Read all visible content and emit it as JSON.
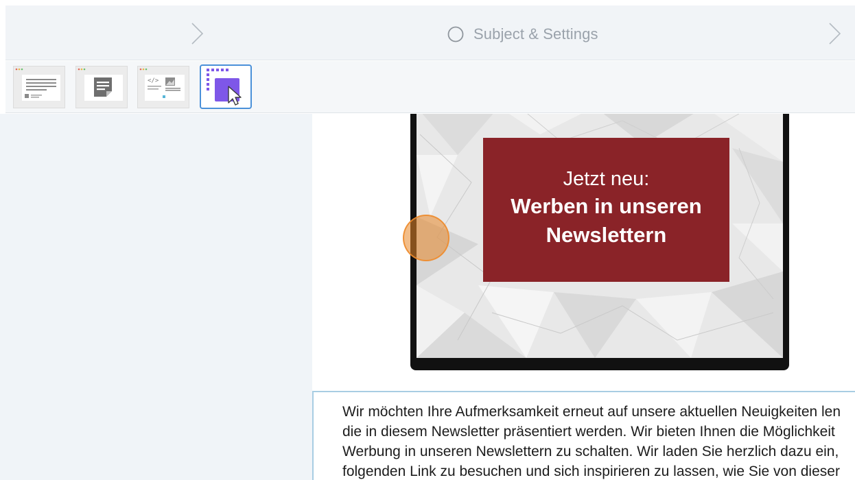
{
  "stepbar": {
    "current_step_label": "Subject & Settings"
  },
  "toolbar": {
    "thumbnails": [
      {
        "name": "text-layout-template",
        "selected": false
      },
      {
        "name": "note-template",
        "selected": false
      },
      {
        "name": "code-image-template",
        "selected": false
      },
      {
        "name": "drag-select-block",
        "selected": true
      }
    ]
  },
  "content": {
    "ad": {
      "line1": "Jetzt neu:",
      "line2": "Werben in unseren",
      "line3": "Newslettern"
    },
    "paragraph_lines": [
      "Wir möchten Ihre Aufmerksamkeit erneut auf unsere aktuellen Neuigkeiten len",
      "die in diesem Newsletter präsentiert werden. Wir bieten Ihnen die Möglichkeit",
      "Werbung in unseren Newslettern zu schalten. Wir laden Sie herzlich dazu ein,",
      "folgenden Link zu besuchen und sich inspirieren zu lassen, wie Sie von dieser"
    ]
  },
  "colors": {
    "accent": "#4a90d9",
    "ad_background": "#8a2328",
    "click_marker": "#e88728"
  }
}
